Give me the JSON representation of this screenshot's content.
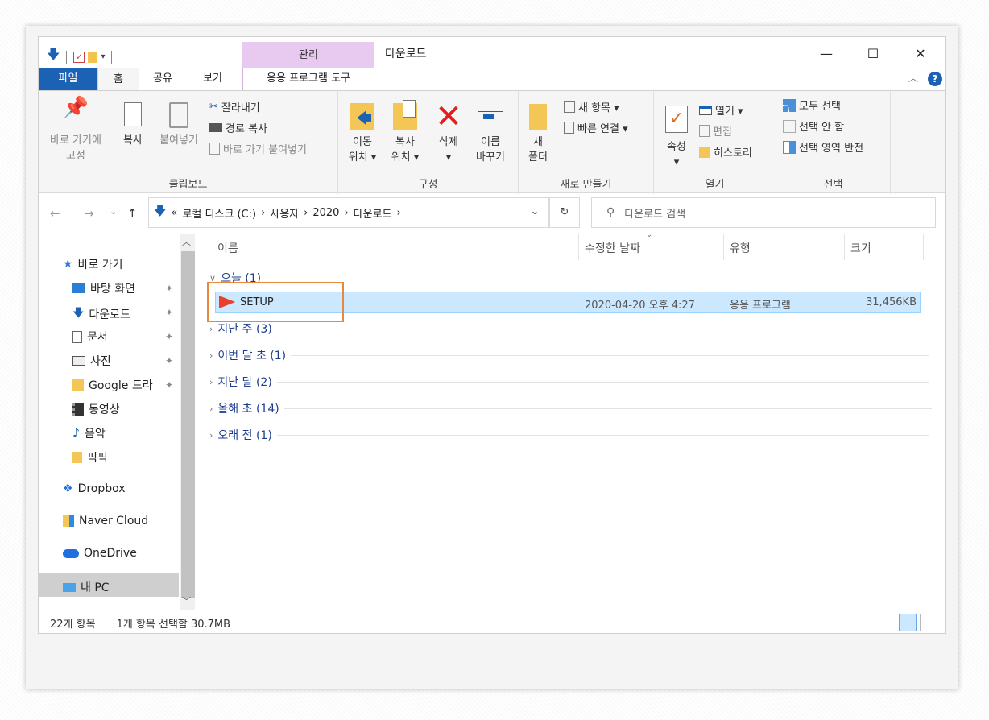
{
  "window": {
    "title": "다운로드",
    "contextual_tab_header": "관리",
    "controls": {
      "minimize": "—",
      "maximize": "☐",
      "close": "✕"
    }
  },
  "tabs": [
    "파일",
    "홈",
    "공유",
    "보기",
    "응용 프로그램 도구"
  ],
  "ribbon": {
    "clipboard": {
      "label": "클립보드",
      "pin_line1": "바로 가기에",
      "pin_line2": "고정",
      "copy": "복사",
      "paste": "붙여넣기",
      "cut": "잘라내기",
      "copy_path": "경로 복사",
      "paste_shortcut": "바로 가기 붙여넣기"
    },
    "organize": {
      "label": "구성",
      "move_line1": "이동",
      "move_line2": "위치 ▾",
      "copyto_line1": "복사",
      "copyto_line2": "위치 ▾",
      "delete_line1": "삭제",
      "delete_line2": "▾",
      "rename_line1": "이름",
      "rename_line2": "바꾸기"
    },
    "new": {
      "label": "새로 만들기",
      "folder_line1": "새",
      "folder_line2": "폴더",
      "new_item": "새 항목 ▾",
      "easy_access": "빠른 연결 ▾"
    },
    "open": {
      "label": "열기",
      "properties": "속성",
      "properties_arrow": "▾",
      "open": "열기 ▾",
      "edit": "편집",
      "history": "히스토리"
    },
    "select": {
      "label": "선택",
      "select_all": "모두 선택",
      "select_none": "선택 안 함",
      "invert": "선택 영역 반전"
    }
  },
  "address": {
    "overflow": "«",
    "crumbs": [
      "로컬 디스크 (C:)",
      "사용자",
      "2020",
      "다운로드"
    ],
    "sep": "›",
    "dropdown": "⌄",
    "refresh": "↻",
    "search_placeholder": "다운로드 검색"
  },
  "nav": {
    "quick_access": "바로 가기",
    "items": [
      "바탕 화면",
      "다운로드",
      "문서",
      "사진",
      "Google 드라",
      "동영상",
      "음악",
      "픽픽"
    ],
    "locations": [
      "Dropbox",
      "Naver Cloud",
      "OneDrive",
      "내 PC"
    ]
  },
  "columns": [
    "이름",
    "수정한 날짜",
    "유형",
    "크기"
  ],
  "groups": [
    {
      "label": "오늘 (1)",
      "expanded": true
    },
    {
      "label": "지난 주 (3)",
      "expanded": false
    },
    {
      "label": "이번 달 초 (1)",
      "expanded": false
    },
    {
      "label": "지난 달 (2)",
      "expanded": false
    },
    {
      "label": "올해 초 (14)",
      "expanded": false
    },
    {
      "label": "오래 전 (1)",
      "expanded": false
    }
  ],
  "file": {
    "name": "SETUP",
    "date": "2020-04-20 오후 4:27",
    "type": "응용 프로그램",
    "size": "31,456KB"
  },
  "status": {
    "count": "22개 항목",
    "selection": "1개 항목 선택함 30.7MB"
  },
  "colors": {
    "accent": "#1c62b4",
    "selection": "#cce8ff",
    "highlight_box": "#e8893a",
    "manage_tab": "#e8c9f0"
  }
}
